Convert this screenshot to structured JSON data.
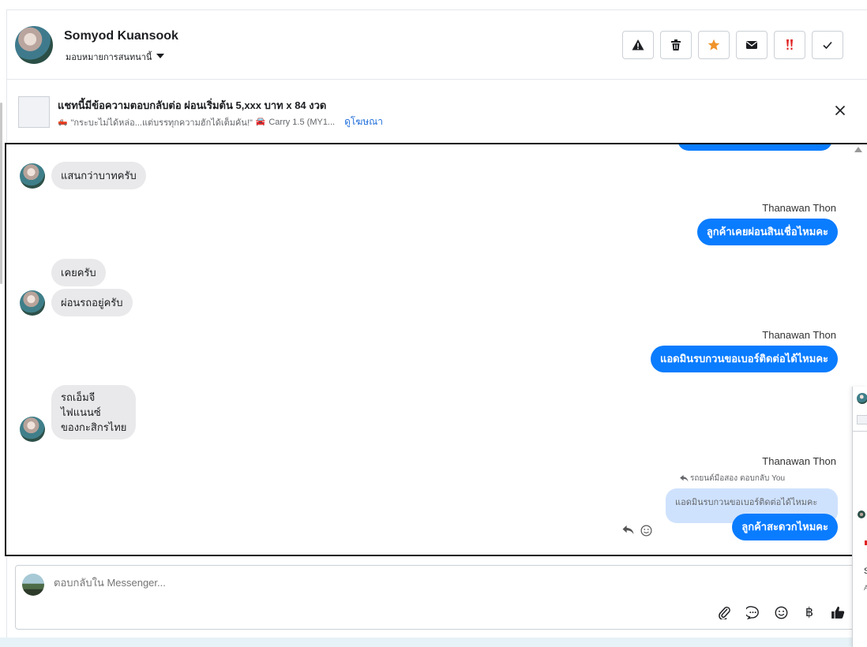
{
  "header": {
    "name": "Somyod Kuansook",
    "assign_label": "มอบหมายการสนทนานี้",
    "actions": [
      "spam",
      "delete",
      "star",
      "mark-unread",
      "follow-up",
      "done"
    ]
  },
  "ad_banner": {
    "title": "แชทนี้มีข้อความตอบกลับต่อ ผ่อนเริ่มต้น 5,xxx บาท x 84 งวด",
    "subtitle_part1": "\"กระบะไม่ได้หล่อ...แต่บรรทุกความฮักได้เต็มคัน!\"",
    "subtitle_part2": "Carry 1.5 (MY1...",
    "link": "ดูโฆษณา"
  },
  "messages": [
    {
      "from": "customer",
      "text": "แสนกว่าบาทครับ"
    },
    {
      "from": "page",
      "sender": "Thanawan Thon",
      "text": "ลูกค้าเคยผ่อนสินเชื่อไหมคะ"
    },
    {
      "from": "customer",
      "text": "เคยครับ"
    },
    {
      "from": "customer",
      "text": "ผ่อนรถอยู่ครับ"
    },
    {
      "from": "page",
      "sender": "Thanawan Thon",
      "text": "แอดมินรบกวนขอเบอร์ติดต่อได้ไหมคะ"
    },
    {
      "from": "customer",
      "lines": [
        "รถเอ็มจี",
        "ไฟแนนซ์",
        "ของกะสิกรไทย"
      ]
    },
    {
      "from": "page",
      "sender": "Thanawan Thon",
      "reply_meta": "รถยนต์มือสอง ตอบกลับ You",
      "quoted": "แอดมินรบกวนขอเบอร์ติดต่อได้ไหมคะ",
      "text": "ลูกค้าสะดวกไหมคะ"
    }
  ],
  "composer": {
    "placeholder": "ตอบกลับใน Messenger...",
    "tools": [
      "attach-icon",
      "saved-reply-icon",
      "emoji-icon",
      "baht-icon",
      "like-icon"
    ]
  },
  "right_panel": {
    "initial": "S",
    "sub": "A"
  },
  "colors": {
    "accent": "#0a7cff",
    "incoming_bubble": "#e9e9eb",
    "quoted_bubble": "#cfe2fd",
    "star": "#f0932b",
    "alert": "#e02020"
  }
}
